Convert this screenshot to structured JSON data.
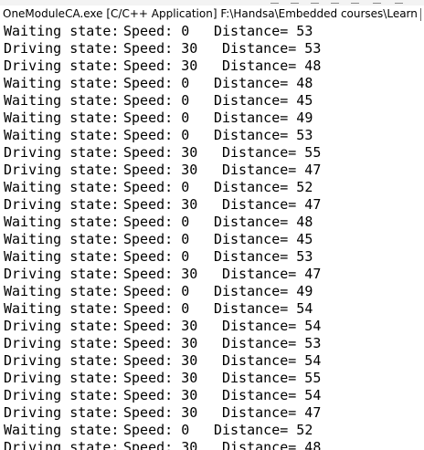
{
  "window": {
    "title": "OneModuleCA.exe [C/C++ Application] F:\\Handsa\\Embedded courses\\Learn in depth\\L"
  },
  "console": {
    "lines": [
      {
        "state": "Waiting state:",
        "speed": "Speed: 0",
        "distance": "Distance= 53"
      },
      {
        "state": "Driving state:",
        "speed": "Speed: 30",
        "distance": "Distance= 53"
      },
      {
        "state": "Driving state:",
        "speed": "Speed: 30",
        "distance": "Distance= 48"
      },
      {
        "state": "Waiting state:",
        "speed": "Speed: 0",
        "distance": "Distance= 48"
      },
      {
        "state": "Waiting state:",
        "speed": "Speed: 0",
        "distance": "Distance= 45"
      },
      {
        "state": "Waiting state:",
        "speed": "Speed: 0",
        "distance": "Distance= 49"
      },
      {
        "state": "Waiting state:",
        "speed": "Speed: 0",
        "distance": "Distance= 53"
      },
      {
        "state": "Driving state:",
        "speed": "Speed: 30",
        "distance": "Distance= 55"
      },
      {
        "state": "Driving state:",
        "speed": "Speed: 30",
        "distance": "Distance= 47"
      },
      {
        "state": "Waiting state:",
        "speed": "Speed: 0",
        "distance": "Distance= 52"
      },
      {
        "state": "Driving state:",
        "speed": "Speed: 30",
        "distance": "Distance= 47"
      },
      {
        "state": "Waiting state:",
        "speed": "Speed: 0",
        "distance": "Distance= 48"
      },
      {
        "state": "Waiting state:",
        "speed": "Speed: 0",
        "distance": "Distance= 45"
      },
      {
        "state": "Waiting state:",
        "speed": "Speed: 0",
        "distance": "Distance= 53"
      },
      {
        "state": "Driving state:",
        "speed": "Speed: 30",
        "distance": "Distance= 47"
      },
      {
        "state": "Waiting state:",
        "speed": "Speed: 0",
        "distance": "Distance= 49"
      },
      {
        "state": "Waiting state:",
        "speed": "Speed: 0",
        "distance": "Distance= 54"
      },
      {
        "state": "Driving state:",
        "speed": "Speed: 30",
        "distance": "Distance= 54"
      },
      {
        "state": "Driving state:",
        "speed": "Speed: 30",
        "distance": "Distance= 53"
      },
      {
        "state": "Driving state:",
        "speed": "Speed: 30",
        "distance": "Distance= 54"
      },
      {
        "state": "Driving state:",
        "speed": "Speed: 30",
        "distance": "Distance= 55"
      },
      {
        "state": "Driving state:",
        "speed": "Speed: 30",
        "distance": "Distance= 54"
      },
      {
        "state": "Driving state:",
        "speed": "Speed: 30",
        "distance": "Distance= 47"
      },
      {
        "state": "Waiting state:",
        "speed": "Speed: 0",
        "distance": "Distance= 52"
      },
      {
        "state": "Driving state:",
        "speed": "Speed: 30",
        "distance": "Distance= 48"
      }
    ]
  }
}
